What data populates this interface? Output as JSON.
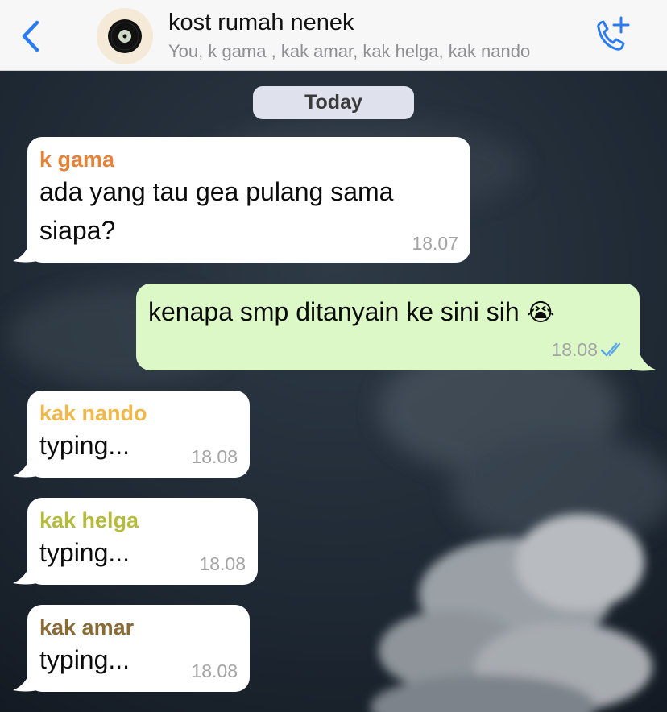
{
  "header": {
    "back_icon": "chevron-left-icon",
    "group_name": "kost rumah nenek",
    "members": "You, k gama , kak amar, kak helga, kak nando",
    "call_icon": "add-call-icon",
    "accent": "#2b7cf0"
  },
  "chat": {
    "date_label": "Today",
    "messages": [
      {
        "sender": "k gama",
        "sender_color": "#e5823a",
        "line1": "ada yang tau gea pulang sama",
        "line2": "siapa?",
        "time": "18.07"
      },
      {
        "text": "kenapa smp ditanyain ke sini sih",
        "emoji": "😭",
        "time": "18.08",
        "status_icon": "double-check-icon"
      },
      {
        "sender": "kak nando",
        "sender_color": "#f0b84a",
        "text": "typing...",
        "time": "18.08"
      },
      {
        "sender": "kak helga",
        "sender_color": "#b5bb3c",
        "text": "typing...",
        "time": "18.08"
      },
      {
        "sender": "kak amar",
        "sender_color": "#8a6a35",
        "text": "typing...",
        "time": "18.08"
      }
    ]
  }
}
